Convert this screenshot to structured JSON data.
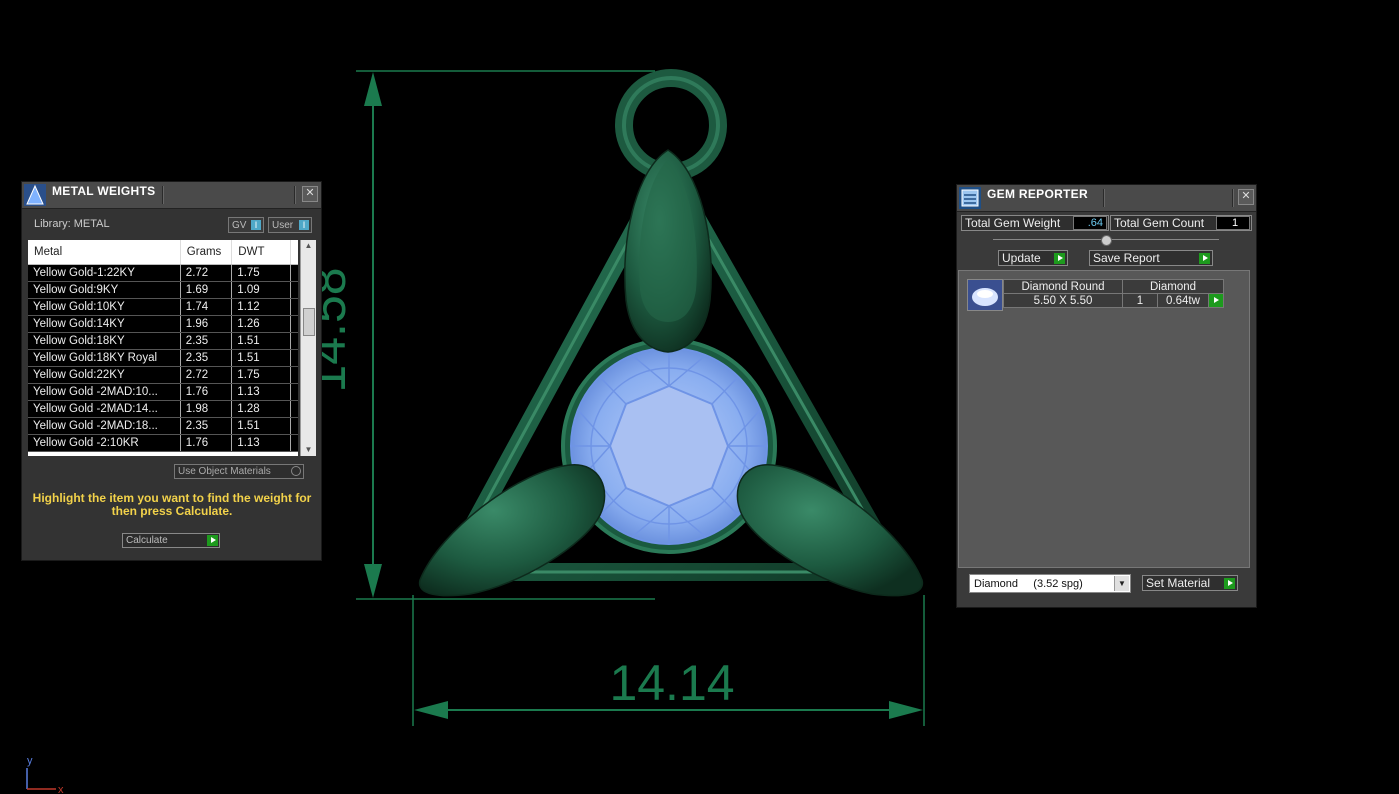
{
  "viewport": {
    "dimension_vertical": "14.58",
    "dimension_horizontal": "14.14",
    "axis_y": "y",
    "axis_x": "x"
  },
  "metal_weights": {
    "title": "METAL WEIGHTS",
    "library_label": "Library: METAL",
    "toggle_gv": "GV",
    "toggle_user": "User",
    "columns": [
      "Metal",
      "Grams",
      "DWT"
    ],
    "rows": [
      [
        "Yellow Gold-1:22KY",
        "2.72",
        "1.75"
      ],
      [
        "Yellow Gold:9KY",
        "1.69",
        "1.09"
      ],
      [
        "Yellow Gold:10KY",
        "1.74",
        "1.12"
      ],
      [
        "Yellow Gold:14KY",
        "1.96",
        "1.26"
      ],
      [
        "Yellow Gold:18KY",
        "2.35",
        "1.51"
      ],
      [
        "Yellow Gold:18KY Royal",
        "2.35",
        "1.51"
      ],
      [
        "Yellow Gold:22KY",
        "2.72",
        "1.75"
      ],
      [
        "Yellow Gold -2MAD:10...",
        "1.76",
        "1.13"
      ],
      [
        "Yellow Gold -2MAD:14...",
        "1.98",
        "1.28"
      ],
      [
        "Yellow Gold -2MAD:18...",
        "2.35",
        "1.51"
      ],
      [
        "Yellow Gold -2:10KR",
        "1.76",
        "1.13"
      ]
    ],
    "use_object_materials": "Use Object Materials",
    "hint": "Highlight the item you want to find the weight for then press Calculate.",
    "calculate_label": "Calculate"
  },
  "gem_reporter": {
    "title": "GEM REPORTER",
    "total_weight_label": "Total Gem Weight",
    "total_weight_value": ".64",
    "total_count_label": "Total Gem Count",
    "total_count_value": "1",
    "update_label": "Update",
    "save_report_label": "Save Report",
    "gem_row": {
      "shape": "Diamond Round",
      "material": "Diamond",
      "size": "5.50 X 5.50",
      "count": "1",
      "weight": "0.64tw"
    },
    "material_select": "Diamond     (3.52 spg)",
    "set_material_label": "Set Material"
  },
  "colors": {
    "dimension_green": "#1b7a4e",
    "model_green": "#1f5e45",
    "gem_blue": "#8fb4f2",
    "hint_yellow": "#f2d24a",
    "button_green": "#1d9a1d"
  }
}
